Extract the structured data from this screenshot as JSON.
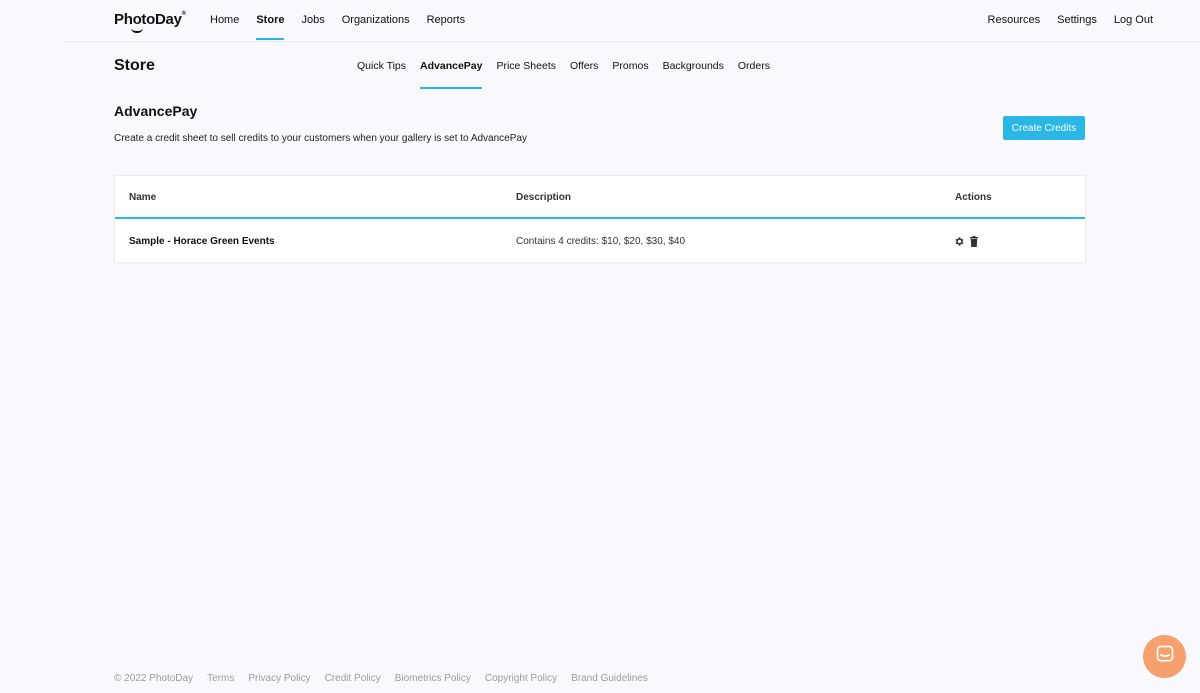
{
  "app": {
    "logo_text": "PhotoDay",
    "logo_mark": "®"
  },
  "main_nav": [
    {
      "label": "Home"
    },
    {
      "label": "Store"
    },
    {
      "label": "Jobs"
    },
    {
      "label": "Organizations"
    },
    {
      "label": "Reports"
    }
  ],
  "main_nav_active": "Store",
  "right_nav": [
    {
      "label": "Resources"
    },
    {
      "label": "Settings"
    },
    {
      "label": "Log Out"
    }
  ],
  "page": {
    "title": "Store"
  },
  "sub_nav": [
    {
      "label": "Quick Tips"
    },
    {
      "label": "AdvancePay"
    },
    {
      "label": "Price Sheets"
    },
    {
      "label": "Offers"
    },
    {
      "label": "Promos"
    },
    {
      "label": "Backgrounds"
    },
    {
      "label": "Orders"
    }
  ],
  "sub_nav_active": "AdvancePay",
  "section": {
    "title": "AdvancePay",
    "description": "Create a credit sheet to sell credits to your customers when your gallery is set to AdvancePay",
    "create_button": "Create Credits"
  },
  "table": {
    "columns": [
      "Name",
      "Description",
      "Actions"
    ],
    "rows": [
      {
        "name": "Sample - Horace Green Events",
        "description": "Contains 4 credits: $10, $20, $30, $40",
        "actions": [
          "gear-icon",
          "trash-icon"
        ]
      }
    ]
  },
  "footer": {
    "copyright": "© 2022 PhotoDay",
    "links": [
      "Terms",
      "Privacy Policy",
      "Credit Policy",
      "Biometrics Policy",
      "Copyright Policy",
      "Brand Guidelines"
    ]
  },
  "colors": {
    "accent": "#2ab7e6",
    "chat_bubble": "#f5a06d",
    "background": "#f9f9fd"
  },
  "icons": {
    "chat": "chat-icon"
  }
}
